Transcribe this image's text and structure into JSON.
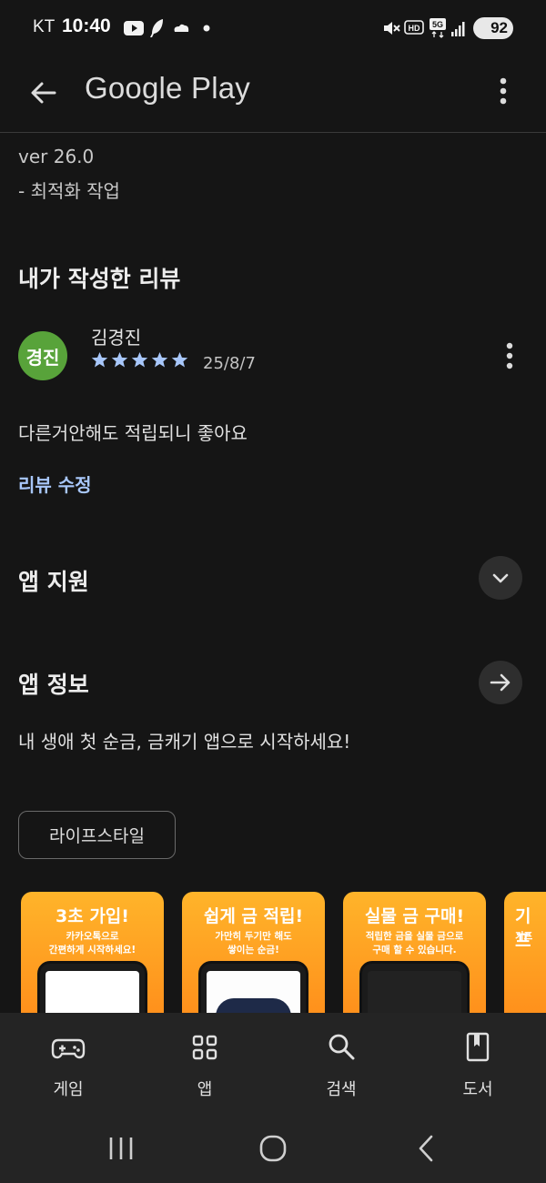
{
  "status_bar": {
    "carrier": "KT",
    "time": "10:40",
    "battery": "92",
    "icons": [
      "youtube-icon",
      "feather-icon",
      "cloud-icon",
      "dot-icon",
      "mute-icon",
      "hd-icon",
      "5g-icon",
      "signal-icon",
      "battery-icon"
    ]
  },
  "app_bar": {
    "title": "Google Play",
    "back_icon": "arrow-back-icon",
    "menu_icon": "more-vertical-icon"
  },
  "whats_new": {
    "version": "ver 26.0",
    "note": "- 최적화 작업"
  },
  "my_review": {
    "heading": "내가 작성한 리뷰",
    "avatar_text": "경진",
    "reviewer": "김경진",
    "rating": 5,
    "max_rating": 5,
    "date": "25/8/7",
    "text": "다른거안해도 적립되니 좋아요",
    "edit_label": "리뷰 수정"
  },
  "sections": {
    "support_title": "앱 지원",
    "about_title": "앱 정보",
    "about_desc": "내 생애 첫 순금, 금캐기 앱으로 시작하세요!"
  },
  "category_chip": "라이프스타일",
  "screenshots": [
    {
      "head": "3초 가입!",
      "sub1": "카카오톡으로",
      "sub2": "간편하게 시작하세요!"
    },
    {
      "head": "쉽게 금 적립!",
      "sub1": "가만히 두기만 해도",
      "sub2": "쌓이는 순금!"
    },
    {
      "head": "실물 금 구매!",
      "sub1": "적립한 금을 실물 금으로",
      "sub2": "구매 할 수 있습니다."
    },
    {
      "head": "기프",
      "sub1": "기프",
      "sub2": ""
    }
  ],
  "bottom_nav": [
    {
      "label": "게임",
      "icon": "gamepad-icon"
    },
    {
      "label": "앱",
      "icon": "apps-grid-icon"
    },
    {
      "label": "검색",
      "icon": "search-icon"
    },
    {
      "label": "도서",
      "icon": "book-icon"
    }
  ],
  "colors": {
    "background": "#151515",
    "accent_link": "#a8c7fa",
    "star": "#a8c7fa",
    "avatar": "#58a33a",
    "card_orange": "#ff9d1f"
  }
}
